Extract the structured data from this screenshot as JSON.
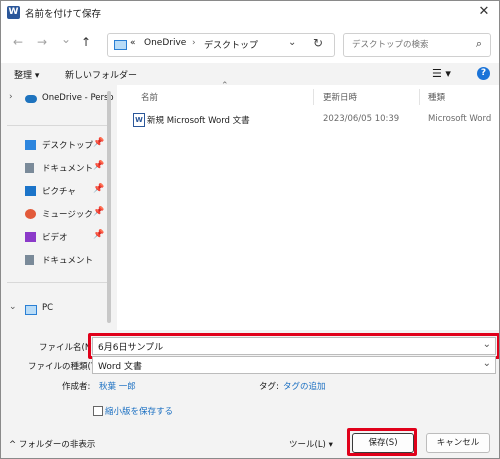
{
  "window": {
    "title": "名前を付けて保存",
    "close": "✕"
  },
  "nav": {
    "back": "←",
    "forward": "→",
    "history": "⌄",
    "up": "↑",
    "crumb_prefix": "«",
    "crumbs": [
      "OneDrive",
      "デスクトップ"
    ],
    "separator": "›",
    "dropdown": "⌄",
    "refresh": "↻",
    "search_placeholder": "デスクトップの検索",
    "search_icon": "⌕"
  },
  "commands": {
    "organize": "整理 ▾",
    "new_folder": "新しいフォルダー",
    "view": "☰ ▾",
    "help": "?"
  },
  "sidebar": {
    "onedrive": "OneDrive - Perso",
    "items": [
      {
        "label": "デスクトップ",
        "icon": "desktop-icon",
        "color": "#2e86de"
      },
      {
        "label": "ドキュメント",
        "icon": "documents-icon",
        "color": "#7a8a99"
      },
      {
        "label": "ピクチャ",
        "icon": "pictures-icon",
        "color": "#1b74c9"
      },
      {
        "label": "ミュージック",
        "icon": "music-icon",
        "color": "#e25a3a"
      },
      {
        "label": "ビデオ",
        "icon": "videos-icon",
        "color": "#8b3ac9"
      },
      {
        "label": "ドキュメント",
        "icon": "documents-icon",
        "color": "#7a8a99"
      }
    ],
    "pc": "PC"
  },
  "filelist": {
    "columns": [
      "名前",
      "更新日時",
      "種類"
    ],
    "rows": [
      {
        "name": "新規 Microsoft Word 文書",
        "modified": "2023/06/05 10:39",
        "type": "Microsoft Word"
      }
    ]
  },
  "form": {
    "filename_label": "ファイル名(N):",
    "filename_value": "6月6日サンプル",
    "filetype_label": "ファイルの種類(T):",
    "filetype_value": "Word 文書",
    "author_label": "作成者:",
    "author_value": "秋葉 一郎",
    "tags_label": "タグ:",
    "tags_value": "タグの追加",
    "thumbnail_label": "縮小版を保存する"
  },
  "footer": {
    "hide_folders": "^ フォルダーの非表示",
    "tools": "ツール(L)  ▾",
    "save": "保存(S)",
    "cancel": "キャンセル"
  },
  "colors": {
    "highlight": "#e0001a",
    "accent": "#1a73d8",
    "link": "#1a6fc2"
  }
}
